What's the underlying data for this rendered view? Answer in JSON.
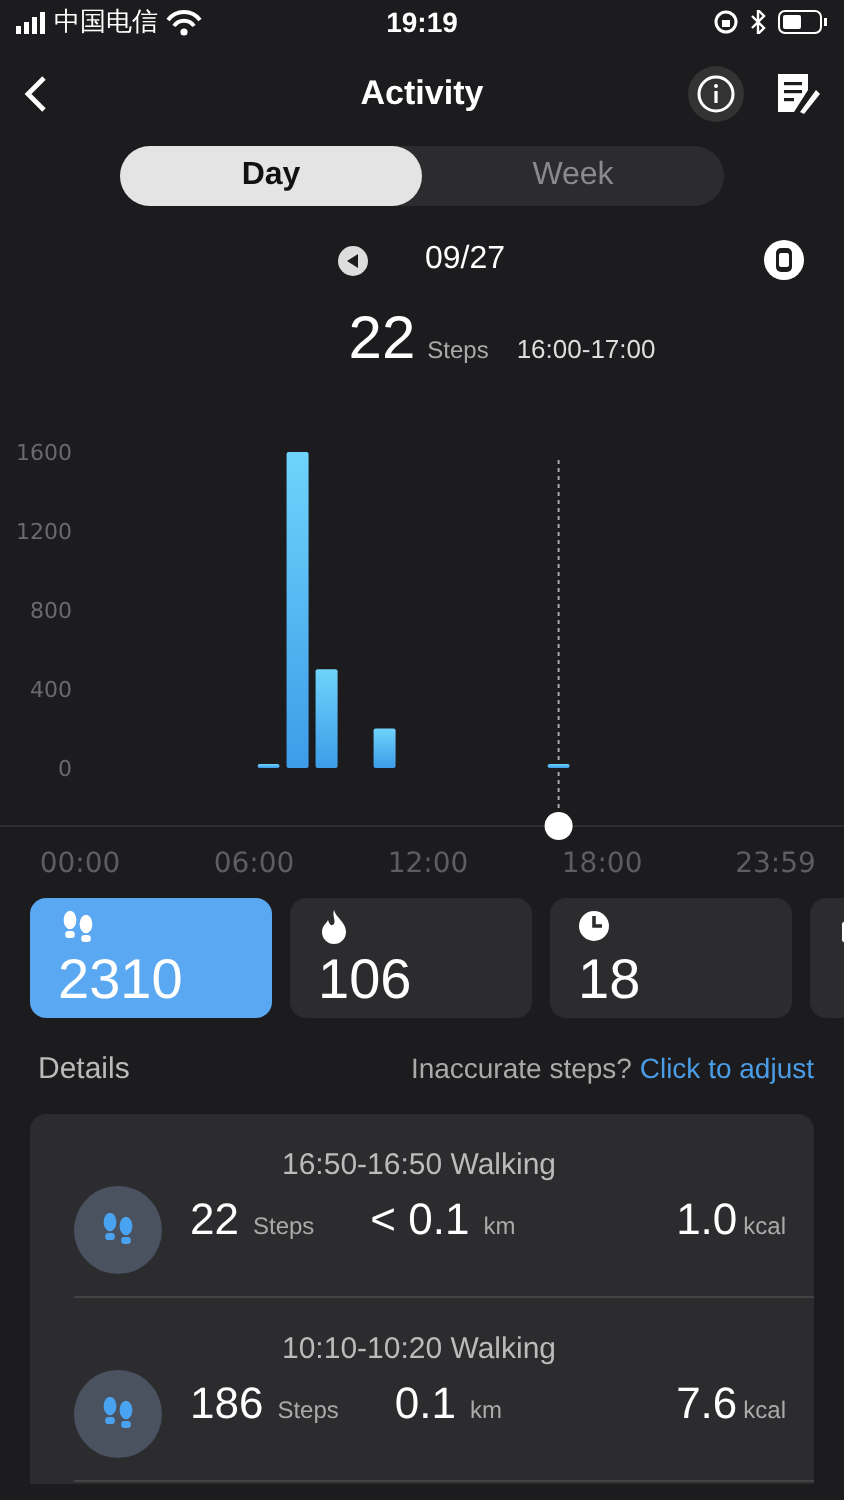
{
  "status_bar": {
    "carrier": "中国电信",
    "time": "19:19"
  },
  "header": {
    "title": "Activity"
  },
  "tabs": [
    {
      "label": "Day",
      "selected": true
    },
    {
      "label": "Week",
      "selected": false
    }
  ],
  "date": {
    "label": "09/27"
  },
  "summary": {
    "value": "22",
    "unit": "Steps",
    "range": "16:00-17:00"
  },
  "chart": {
    "chart_data": {
      "type": "bar",
      "x": [
        6.5,
        7.5,
        8.5,
        10.5,
        16.5
      ],
      "values": [
        20,
        1600,
        500,
        200,
        20
      ],
      "xlim": [
        -2.76,
        26.34
      ],
      "ylim": [
        0,
        1600
      ],
      "yticks": [
        0,
        400,
        800,
        1200,
        1600
      ],
      "xticks": [
        {
          "value": 0,
          "label": "00:00"
        },
        {
          "value": 6,
          "label": "06:00"
        },
        {
          "value": 12,
          "label": "12:00"
        },
        {
          "value": 18,
          "label": "18:00"
        },
        {
          "value": 23.98,
          "label": "23:59"
        }
      ],
      "ref_lines": [
        {
          "axis": "x",
          "value": 16.5
        }
      ]
    }
  },
  "stat_cards": [
    {
      "kind": "steps",
      "value": "2310",
      "selected": true
    },
    {
      "kind": "calories",
      "value": "106",
      "selected": false
    },
    {
      "kind": "duration",
      "value": "18",
      "selected": false
    },
    {
      "kind": "stand",
      "selected": false
    }
  ],
  "details": {
    "title": "Details",
    "prompt": "Inaccurate steps?",
    "link": "Click to adjust"
  },
  "records": [
    {
      "title": "16:50-16:50 Walking",
      "steps": "22",
      "steps_unit": "Steps",
      "distance": "< 0.1",
      "distance_unit": "km",
      "energy": "1.0",
      "energy_unit": "kcal"
    },
    {
      "title": "10:10-10:20 Walking",
      "steps": "186",
      "steps_unit": "Steps",
      "distance": "0.1",
      "distance_unit": "km",
      "energy": "7.6",
      "energy_unit": "kcal"
    }
  ]
}
